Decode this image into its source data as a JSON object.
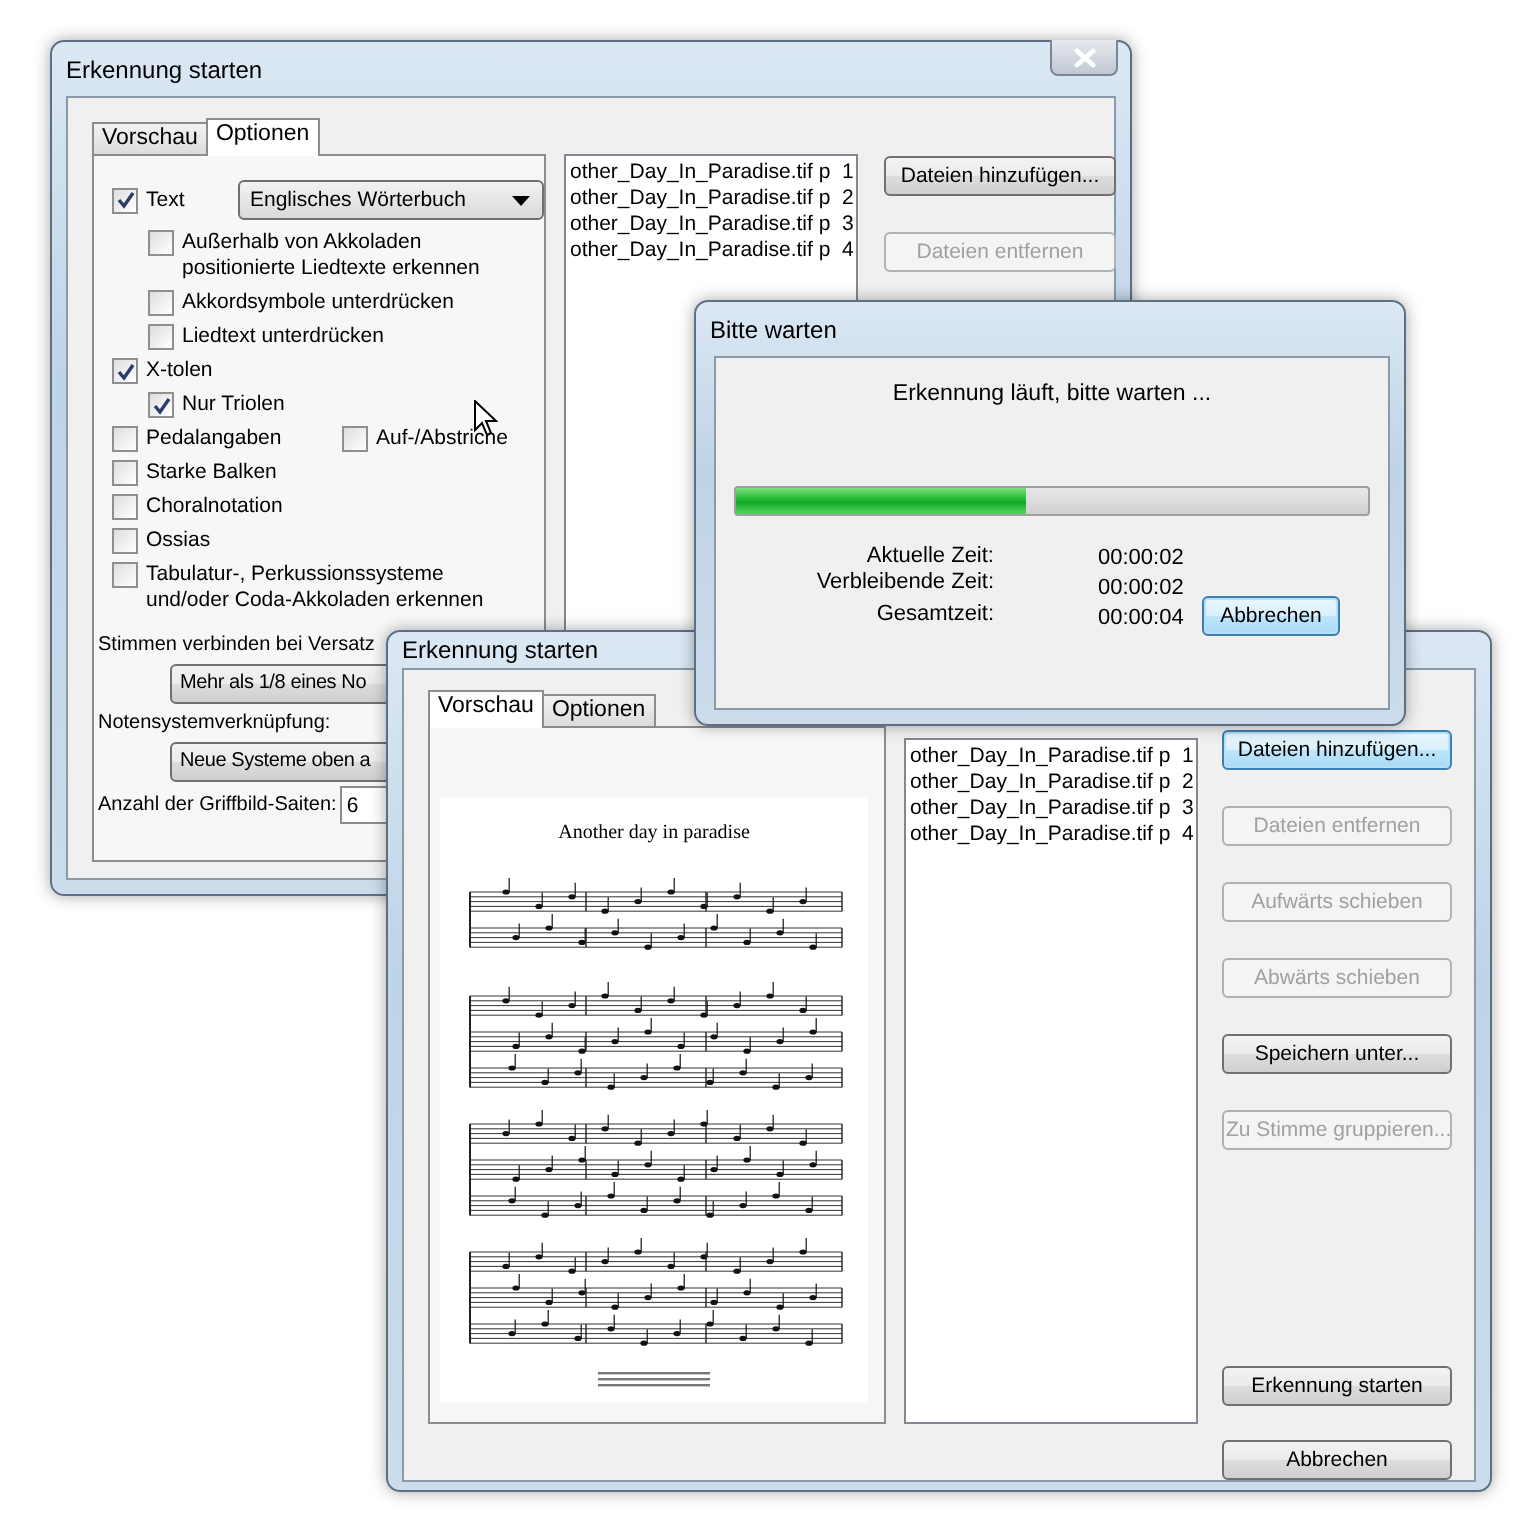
{
  "back_window": {
    "title": "Erkennung starten",
    "tabs": [
      {
        "label": "Vorschau",
        "selected": false
      },
      {
        "label": "Optionen",
        "selected": true
      }
    ],
    "options": [
      {
        "label": "Text",
        "checked": true,
        "dropdown": "Englisches Wörterbuch",
        "children": [
          {
            "label": "Außerhalb von Akkoladen positionierte Liedtexte erkennen",
            "checked": false
          },
          {
            "label": "Akkordsymbole unterdrücken",
            "checked": false
          },
          {
            "label": "Liedtext unterdrücken",
            "checked": false
          }
        ]
      },
      {
        "label": "X-tolen",
        "checked": true,
        "children": [
          {
            "label": "Nur Triolen",
            "checked": true
          }
        ]
      },
      {
        "label": "Pedalangaben",
        "checked": false,
        "beside": {
          "label": "Auf-/Abstriche",
          "checked": false
        }
      },
      {
        "label": "Starke Balken",
        "checked": false
      },
      {
        "label": "Choralnotation",
        "checked": false
      },
      {
        "label": "Ossias",
        "checked": false
      },
      {
        "label": "Tabulatur-, Perkussionssysteme und/oder Coda-Akkoladen erkennen",
        "checked": false
      }
    ],
    "settings": [
      {
        "kind": "button",
        "label": "Stimmen verbinden bei Versatz",
        "value": "Mehr als 1/8 eines No"
      },
      {
        "kind": "button",
        "label": "Notensystemverknüpfung:",
        "value": "Neue Systeme oben a"
      },
      {
        "kind": "field",
        "label": "Anzahl der Griffbild-Saiten:",
        "value": "6"
      }
    ],
    "files": [
      "other_Day_In_Paradise.tif p  1",
      "other_Day_In_Paradise.tif p  2",
      "other_Day_In_Paradise.tif p  3",
      "other_Day_In_Paradise.tif p  4"
    ],
    "buttons": [
      {
        "label": "Dateien hinzufügen...",
        "disabled": false
      },
      {
        "label": "Dateien entfernen",
        "disabled": true
      }
    ]
  },
  "progress_dialog": {
    "title": "Bitte warten",
    "message": "Erkennung läuft, bitte warten ...",
    "level": 0.46,
    "times": [
      {
        "label": "Aktuelle Zeit:",
        "value": "00:00:02"
      },
      {
        "label": "Verbleibende Zeit:",
        "value": "00:00:02"
      },
      {
        "label": "Gesamtzeit:",
        "value": "00:00:04"
      }
    ],
    "button": {
      "label": "Abbrechen",
      "focused": true
    }
  },
  "front_window": {
    "title": "Erkennung starten",
    "tabs": [
      {
        "label": "Vorschau",
        "selected": true
      },
      {
        "label": "Optionen",
        "selected": false
      }
    ],
    "preview": {
      "title": "Another day in paradise"
    },
    "files": [
      "other_Day_In_Paradise.tif p  1",
      "other_Day_In_Paradise.tif p  2",
      "other_Day_In_Paradise.tif p  3",
      "other_Day_In_Paradise.tif p  4"
    ],
    "buttons": [
      {
        "label": "Dateien hinzufügen...",
        "disabled": false,
        "focused": true
      },
      {
        "label": "Dateien entfernen",
        "disabled": true,
        "focused": false
      },
      {
        "label": "Aufwärts schieben",
        "disabled": true,
        "focused": false
      },
      {
        "label": "Abwärts schieben",
        "disabled": true,
        "focused": false
      },
      {
        "label": "Speichern unter...",
        "disabled": false,
        "focused": false
      },
      {
        "label": "Zu Stimme gruppieren...",
        "disabled": true,
        "focused": false
      }
    ],
    "bottom_buttons": [
      {
        "label": "Erkennung starten",
        "disabled": false,
        "focused": false
      },
      {
        "label": "Abbrechen",
        "disabled": false,
        "focused": false
      }
    ]
  }
}
